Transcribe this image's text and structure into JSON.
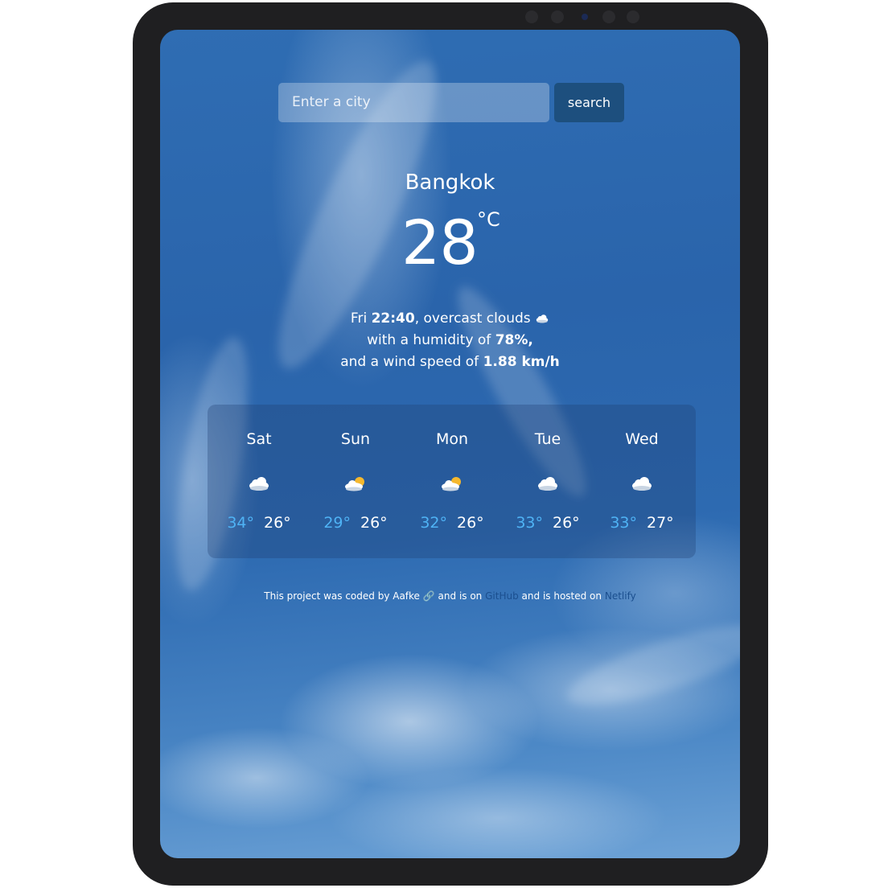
{
  "search": {
    "placeholder": "Enter a city",
    "button_label": "search"
  },
  "current": {
    "city": "Bangkok",
    "temperature": "28",
    "unit": "°C",
    "day": "Fri",
    "time": "22:40",
    "condition": "overcast clouds",
    "humidity_prefix": "with a humidity of",
    "humidity": "78%,",
    "wind_prefix": "and a wind speed of",
    "wind": "1.88 km/h",
    "icon": "cloud-icon"
  },
  "forecast": [
    {
      "day": "Sat",
      "high": "34°",
      "low": "26°",
      "icon": "cloud-icon"
    },
    {
      "day": "Sun",
      "high": "29°",
      "low": "26°",
      "icon": "sun-cloud-icon"
    },
    {
      "day": "Mon",
      "high": "32°",
      "low": "26°",
      "icon": "sun-cloud-icon"
    },
    {
      "day": "Tue",
      "high": "33°",
      "low": "26°",
      "icon": "cloud-icon"
    },
    {
      "day": "Wed",
      "high": "33°",
      "low": "27°",
      "icon": "cloud-icon"
    }
  ],
  "footer": {
    "text1": "This project was coded by Aafke",
    "text2": "and is on",
    "github": "GitHub",
    "text3": "and is hosted on",
    "netlify": "Netlify"
  },
  "colors": {
    "high_temp": "#4fb3f5",
    "search_button": "#1d4f7e",
    "link": "#1b4f8f",
    "bezel": "#1f1f21"
  }
}
